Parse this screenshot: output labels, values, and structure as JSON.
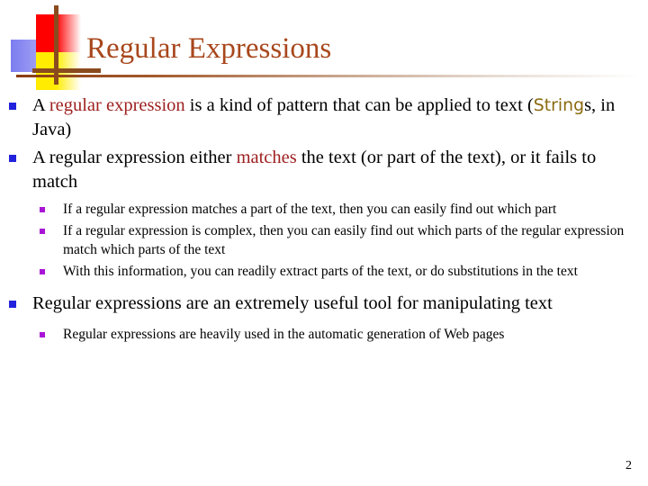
{
  "slide": {
    "title": "Regular Expressions",
    "page_number": "2",
    "title_color": "#a8471c",
    "bullet_color_level1": "#2222dd",
    "bullet_color_level2": "#a915d6",
    "emphasis_color": "#9e2020",
    "code_color": "#8a6a10"
  },
  "decoration": {
    "red_block_color": "#fe0000",
    "yellow_block_color": "#ffec00",
    "blue_block_color": "#7c7cf0",
    "cross_line_color": "#8a4b1e"
  },
  "content": {
    "bullet1": {
      "part_a": "A ",
      "emphasis": "regular expression",
      "part_b": " is a kind of pattern that can be applied to text (",
      "code": "String",
      "part_c": "s, in Java)"
    },
    "bullet2": {
      "part_a": "A regular expression either ",
      "emphasis": "matches",
      "part_b": " the text (or part of the text), or it fails to match"
    },
    "subbullet1": "If a regular expression matches a part of the text, then you can easily find out which part",
    "subbullet2": "If a regular expression is complex, then you can easily find out which parts of the regular expression match which parts of the text",
    "subbullet3": "With this information, you can readily extract parts of the text, or do substitutions in the text",
    "bullet3": "Regular expressions are an extremely useful tool for manipulating text",
    "subbullet4": "Regular expressions are heavily used in the automatic generation of Web pages"
  }
}
